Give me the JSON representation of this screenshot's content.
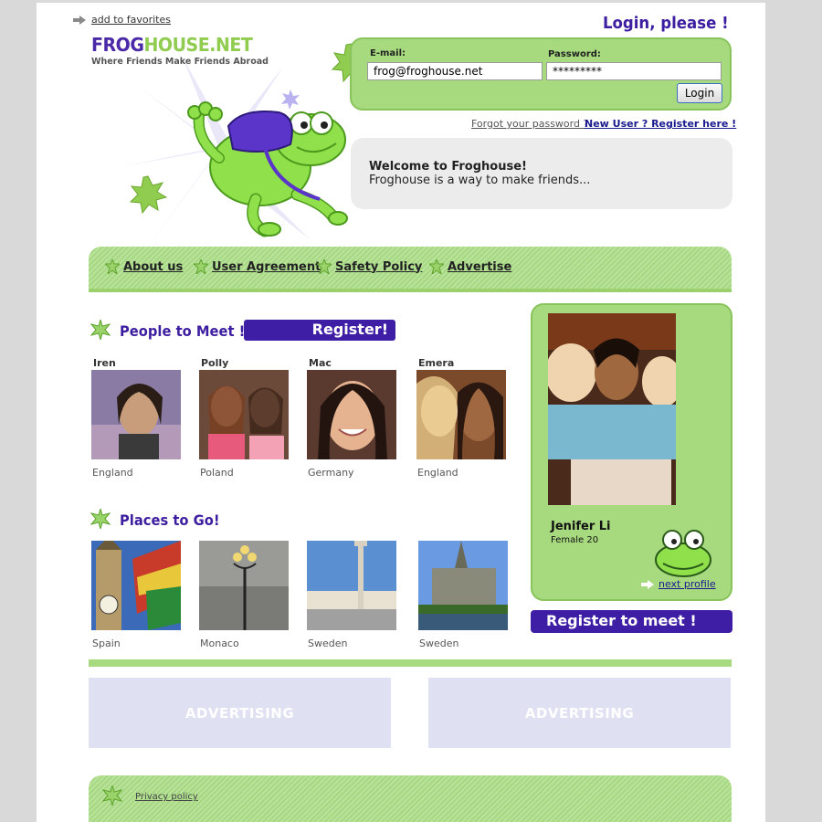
{
  "header": {
    "add_favorites": "add to favorites",
    "logo_prefix": "FROG",
    "logo_suffix": "HOUSE.NET",
    "tagline": "Where Friends Make Friends Abroad"
  },
  "login": {
    "title": "Login, please !",
    "email_label": "E-mail:",
    "email_value": "frog@froghouse.net",
    "password_label": "Password:",
    "password_value": "*********",
    "button": "Login",
    "forgot": "Forgot your password ?",
    "new_user": "New User ? Register here !"
  },
  "welcome": {
    "title": "Welcome to Froghouse!",
    "text": "Froghouse is a way to make friends..."
  },
  "nav": {
    "items": [
      {
        "label": "About us"
      },
      {
        "label": "User Agreement"
      },
      {
        "label": "Safety Policy"
      },
      {
        "label": "Advertise"
      }
    ]
  },
  "people": {
    "title": "People to Meet !",
    "register": "Register!",
    "items": [
      {
        "name": "Iren",
        "country": "England"
      },
      {
        "name": "Polly",
        "country": "Poland"
      },
      {
        "name": "Mac",
        "country": "Germany"
      },
      {
        "name": "Emera",
        "country": "England"
      }
    ]
  },
  "places": {
    "title": "Places to Go!",
    "items": [
      {
        "country": "Spain"
      },
      {
        "country": "Monaco"
      },
      {
        "country": "Sweden"
      },
      {
        "country": "Sweden"
      }
    ]
  },
  "profile": {
    "name": "Jenifer Li",
    "info": "Female 20",
    "next": "next profile",
    "register": "Register to meet !"
  },
  "ads": {
    "left": "ADVERTISING",
    "right": "ADVERTISING"
  },
  "footer": {
    "privacy": "Privacy policy"
  },
  "colors": {
    "brand_purple": "#3f1ea6",
    "brand_green": "#a7d97f",
    "ad_bg": "#dfe0f2"
  }
}
